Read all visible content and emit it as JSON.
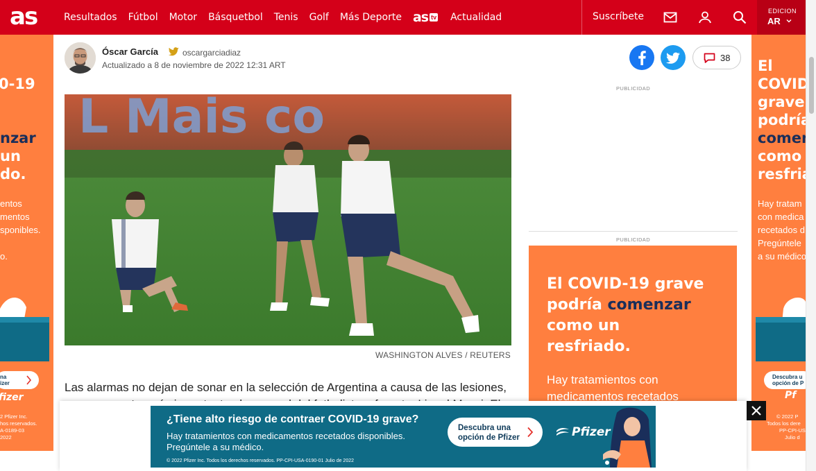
{
  "nav": {
    "logo": "as",
    "items": [
      "Resultados",
      "Fútbol",
      "Motor",
      "Básquetbol",
      "Tenis",
      "Golf",
      "Más Deporte"
    ],
    "astv_logo": "as",
    "astv_badge": "tv",
    "actualidad": "Actualidad",
    "subscribe": "Suscríbete",
    "edition_label": "EDICION",
    "edition_code": "AR"
  },
  "author": {
    "name": "Óscar García",
    "handle": "oscargarciadiaz",
    "updated": "Actualizado a 8 de noviembre de 2022 12:31 ART"
  },
  "share": {
    "comments_count": "38"
  },
  "photo": {
    "credit": "WASHINGTON ALVES / REUTERS",
    "background_text": "L Mais co"
  },
  "article": {
    "first_line": "Las alarmas no dejan de sonar en la selección de Argentina a causa de las lesiones,",
    "second_line": "cuyo encuentro más importante ahora es el del futbolista referente, Lionel Messi. El"
  },
  "ads": {
    "publicidad": "PUBLICIDAD",
    "left": {
      "line1": "0-19",
      "line2": "nzar",
      "line3": "un",
      "line4": "do.",
      "small1": "entos",
      "small2": "mentos",
      "small3": "sponibles.",
      "small4": "o.",
      "pill": "na\nizer",
      "brand": "fizer",
      "legal1": "2 Pfizer Inc.",
      "legal2": "hos reservados.",
      "legal3": "A-0189-03",
      "legal4": "2022"
    },
    "right_side": {
      "line1": "El",
      "line2": "COVID",
      "line3": "grave",
      "line4": "podría",
      "line5": "comen",
      "line6": "como",
      "line7": "resfria",
      "small1": "Hay tratam",
      "small2": "con medica",
      "small3": "recetados d",
      "small4": "Pregúntele",
      "small5": "a su médico",
      "pill1": "Descubra u",
      "pill2": "opción de P",
      "brand": "Pf",
      "legal1": "© 2022 P",
      "legal2": "Todos los dere",
      "legal3": "PP-CPI-US",
      "legal4": "Julio d"
    },
    "box": {
      "line1": "El COVID-19 grave",
      "line2a": "podría ",
      "line2b": "comenzar",
      "line3": "como un",
      "line4": "resfriado.",
      "small1": "Hay tratamientos con",
      "small2": "medicamentos recetados"
    },
    "bottom": {
      "title": "¿Tiene alto riesgo de contraer COVID-19 grave?",
      "sub1": "Hay tratamientos con medicamentos recetados disponibles.",
      "sub2": "Pregúntele a su médico.",
      "legal": "© 2022 Pfizer Inc. Todos los derechos reservados. PP-CPI-USA-0190-01 Julio de 2022",
      "pill1": "Descubra una",
      "pill2": "opción de Pfizer",
      "brand": "Pfizer"
    }
  },
  "colors": {
    "brand_red": "#d40019",
    "ad_orange": "#ff7f3f",
    "ad_teal": "#0f6b86"
  }
}
